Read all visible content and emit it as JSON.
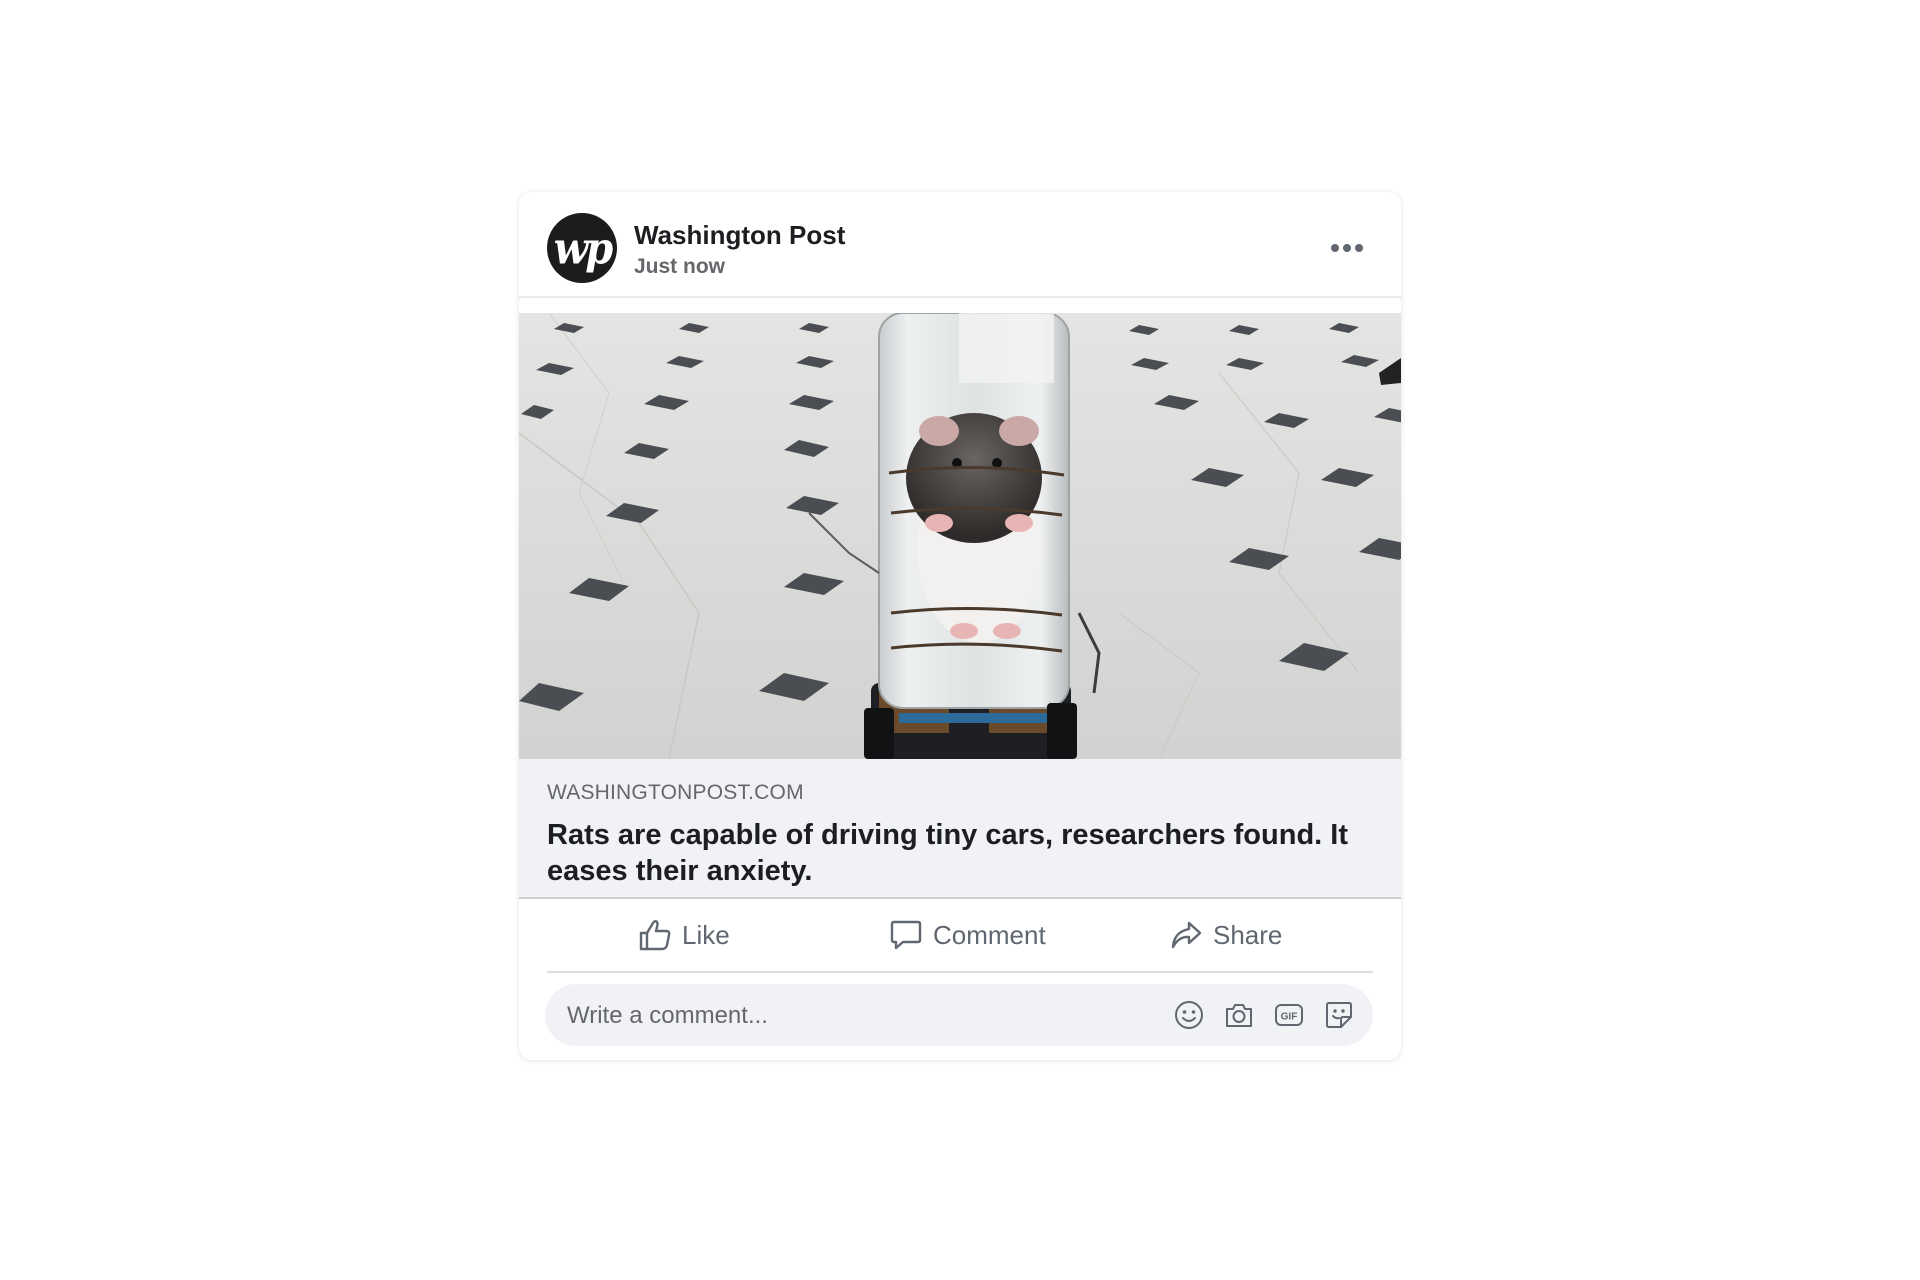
{
  "post": {
    "author": "Washington Post",
    "avatar_text": "wp",
    "timestamp": "Just now",
    "more_icon": "more-horizontal-icon"
  },
  "link": {
    "domain": "WASHINGTONPOST.COM",
    "title": "Rats are capable of driving tiny cars, researchers found. It eases their anxiety."
  },
  "actions": {
    "like_label": "Like",
    "comment_label": "Comment",
    "share_label": "Share"
  },
  "comment": {
    "placeholder": "Write a comment...",
    "gif_text": "GIF",
    "icons": [
      "emoji-icon",
      "camera-icon",
      "gif-icon",
      "sticker-icon"
    ]
  },
  "colors": {
    "text_primary": "#1c1e21",
    "text_secondary": "#65676b",
    "preview_bg": "#f0f2f5"
  }
}
